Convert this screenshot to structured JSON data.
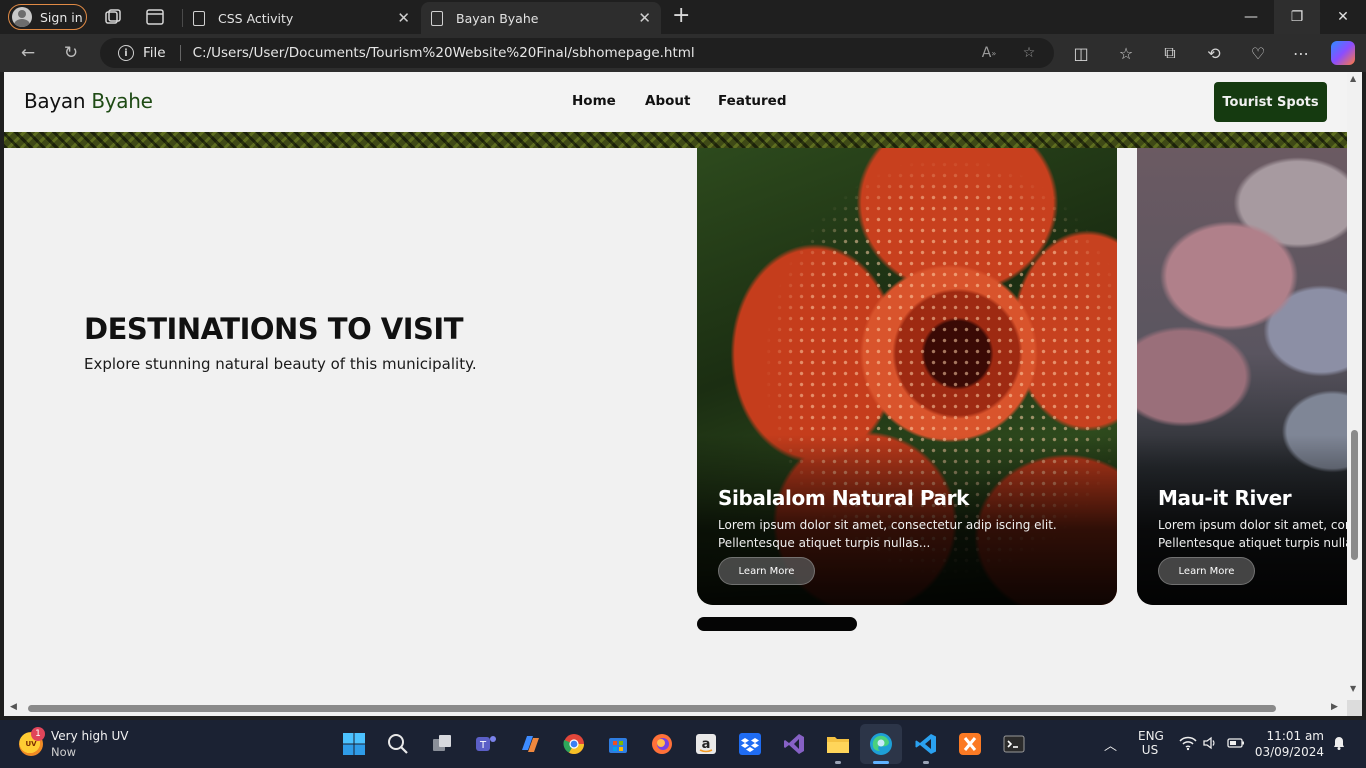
{
  "browser": {
    "signin_label": "Sign in",
    "tabs": [
      {
        "label": "CSS Activity"
      },
      {
        "label": "Bayan Byahe"
      }
    ],
    "address": {
      "file_label": "File",
      "url": "C:/Users/User/Documents/Tourism%20Website%20Final/sbhomepage.html"
    }
  },
  "site": {
    "logo_part1": "Bayan",
    "logo_part2": "Byahe",
    "nav": [
      "Home",
      "About",
      "Featured"
    ],
    "cta_label": "Tourist Spots",
    "hero": {
      "title": "DESTINATIONS TO VISIT",
      "subtitle": "Explore stunning natural beauty of this municipality."
    },
    "cards": [
      {
        "title": "Sibalalom Natural Park",
        "desc_line1": "Lorem ipsum dolor sit amet, consectetur adip iscing elit.",
        "desc_line2": "Pellentesque atiquet turpis nullas...",
        "button": "Learn More"
      },
      {
        "title": "Mau-it River",
        "desc_line1": "Lorem ipsum dolor sit amet, consectetur adip iscing elit.",
        "desc_line2": "Pellentesque atiquet turpis nullas...",
        "button": "Learn More"
      }
    ]
  },
  "taskbar": {
    "weather_title": "Very high UV",
    "weather_sub": "Now",
    "weather_badge": "1",
    "weather_icon_text": "UV",
    "lang_top": "ENG",
    "lang_bottom": "US",
    "time": "11:01 am",
    "date": "03/09/2024"
  },
  "colors": {
    "brand_dark_green": "#153a10",
    "logo_green": "#1e4a14",
    "signin_border": "#e08a45"
  }
}
